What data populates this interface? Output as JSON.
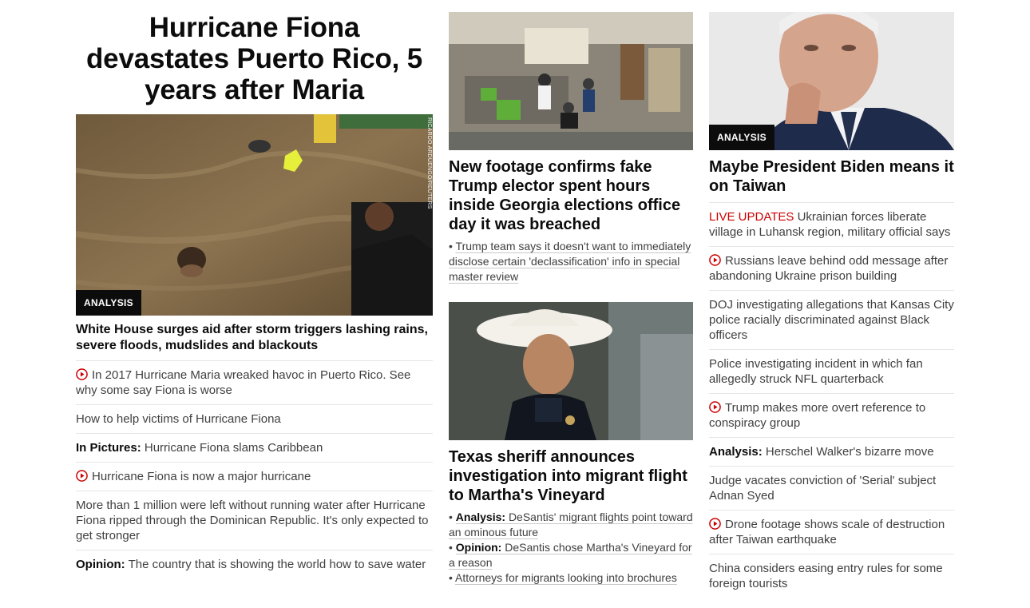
{
  "col1": {
    "main_headline": "Hurricane Fiona devastates Puerto Rico, 5 years after Maria",
    "photo_badge": "ANALYSIS",
    "photo_credit": "RICARDO ARDUENGO/REUTERS",
    "photo_headline": "White House surges aid after storm triggers lashing rains, severe floods, mudslides and blackouts",
    "items": [
      {
        "video": true,
        "label": "",
        "text": "In 2017 Hurricane Maria wreaked havoc in Puerto Rico. See why some say Fiona is worse"
      },
      {
        "video": false,
        "label": "",
        "text": "How to help victims of Hurricane Fiona"
      },
      {
        "video": false,
        "label": "In Pictures:",
        "text": "Hurricane Fiona slams Caribbean"
      },
      {
        "video": true,
        "label": "",
        "text": "Hurricane Fiona is now a major hurricane"
      },
      {
        "video": false,
        "label": "",
        "text": "More than 1 million were left without running water after Hurricane Fiona ripped through the Dominican Republic. It's only expected to get stronger"
      },
      {
        "video": false,
        "label": "Opinion:",
        "text": "The country that is showing the world how to save water"
      }
    ]
  },
  "col2": {
    "story1": {
      "headline": "New footage confirms fake Trump elector spent hours inside Georgia elections office day it was breached",
      "sublinks": [
        {
          "label": "",
          "text": "Trump team says it doesn't want to immediately disclose certain 'declassification' info in special master review"
        }
      ]
    },
    "story2": {
      "headline": "Texas sheriff announces investigation into migrant flight to Martha's Vineyard",
      "sublinks": [
        {
          "label": "Analysis:",
          "text": "DeSantis' migrant flights point toward an ominous future"
        },
        {
          "label": "Opinion:",
          "text": "DeSantis chose Martha's Vineyard for a reason"
        },
        {
          "label": "",
          "text": "Attorneys for migrants looking into brochures"
        }
      ]
    }
  },
  "col3": {
    "photo_badge": "ANALYSIS",
    "headline": "Maybe President Biden means it on Taiwan",
    "items": [
      {
        "video": false,
        "live": "LIVE UPDATES",
        "label": "",
        "text": "Ukrainian forces liberate village in Luhansk region, military official says"
      },
      {
        "video": true,
        "live": "",
        "label": "",
        "text": "Russians leave behind odd message after abandoning Ukraine prison building"
      },
      {
        "video": false,
        "live": "",
        "label": "",
        "text": "DOJ investigating allegations that Kansas City police racially discriminated against Black officers"
      },
      {
        "video": false,
        "live": "",
        "label": "",
        "text": "Police investigating incident in which fan allegedly struck NFL quarterback"
      },
      {
        "video": true,
        "live": "",
        "label": "",
        "text": "Trump makes more overt reference to conspiracy group"
      },
      {
        "video": false,
        "live": "",
        "label": "Analysis:",
        "text": "Herschel Walker's bizarre move"
      },
      {
        "video": false,
        "live": "",
        "label": "",
        "text": "Judge vacates conviction of 'Serial' subject Adnan Syed"
      },
      {
        "video": true,
        "live": "",
        "label": "",
        "text": "Drone footage shows scale of destruction after Taiwan earthquake"
      },
      {
        "video": false,
        "live": "",
        "label": "",
        "text": "China considers easing entry rules for some foreign tourists"
      }
    ]
  },
  "colors": {
    "text": "#0c0c0c",
    "secondary": "#404040",
    "live": "#cc0000",
    "play_icon": "#cc0000",
    "divider": "#e6e6e6",
    "badge_bg": "#0c0c0c"
  },
  "icons": {
    "video": "play-circle-icon"
  }
}
